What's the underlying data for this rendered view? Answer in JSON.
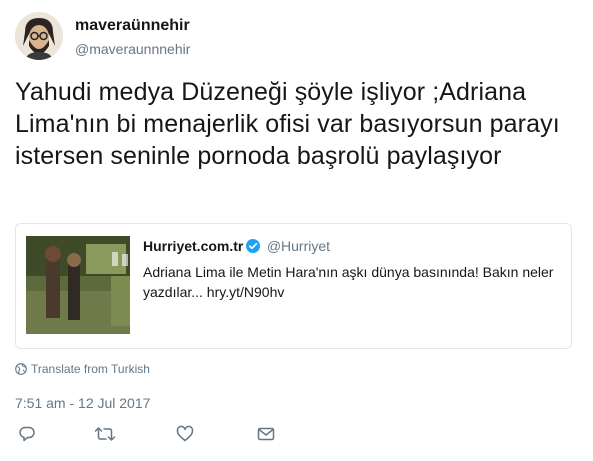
{
  "author": {
    "display_name": "maveraünnehir",
    "handle": "@maveraunnnehir"
  },
  "tweet": {
    "text": "Yahudi medya Düzeneği şöyle işliyor ;Adriana Lima'nın bi menajerlik ofisi var basıyorsun parayı istersen seninle pornoda başrolü paylaşıyor",
    "translate_label": "Translate from Turkish",
    "timestamp": "7:51 am - 12 Jul 2017"
  },
  "quoted_tweet": {
    "display_name": "Hurriyet.com.tr",
    "handle": "@Hurriyet",
    "text": "Adriana Lima ile Metin Hara'nın aşkı dünya basınında! Bakın neler yazdılar... hry.yt/N90hv",
    "verified": true
  },
  "actions": {
    "icons": [
      "reply-icon",
      "retweet-icon",
      "like-icon",
      "message-icon"
    ]
  },
  "colors": {
    "text": "#14171a",
    "muted": "#657786",
    "border": "#e1e8ed",
    "verified": "#1da1f2"
  }
}
